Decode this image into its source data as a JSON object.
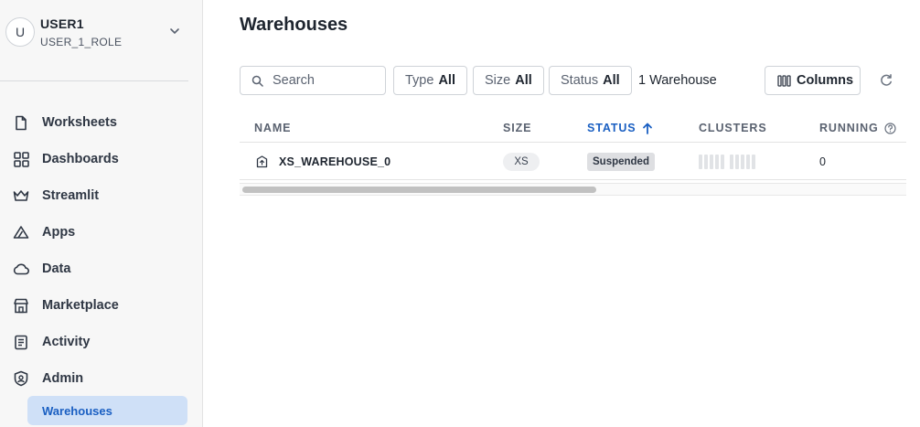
{
  "user": {
    "initial": "U",
    "name": "USER1",
    "role": "USER_1_ROLE"
  },
  "nav": {
    "items": [
      {
        "label": "Worksheets",
        "icon": "document-icon"
      },
      {
        "label": "Dashboards",
        "icon": "grid-icon"
      },
      {
        "label": "Streamlit",
        "icon": "crown-icon"
      },
      {
        "label": "Apps",
        "icon": "apps-icon"
      },
      {
        "label": "Data",
        "icon": "cloud-icon"
      },
      {
        "label": "Marketplace",
        "icon": "store-icon"
      },
      {
        "label": "Activity",
        "icon": "activity-icon"
      },
      {
        "label": "Admin",
        "icon": "shield-icon"
      }
    ],
    "active_sub_item": "Warehouses"
  },
  "main": {
    "title": "Warehouses",
    "search_placeholder": "Search",
    "filters": [
      {
        "label": "Type",
        "value": "All"
      },
      {
        "label": "Size",
        "value": "All"
      },
      {
        "label": "Status",
        "value": "All"
      }
    ],
    "count_text": "1 Warehouse",
    "columns_label": "Columns",
    "accent_color": "#1a5fc2"
  },
  "table": {
    "headers": {
      "name": "NAME",
      "size": "SIZE",
      "status": "STATUS",
      "clusters": "CLUSTERS",
      "running": "RUNNING"
    },
    "sort": {
      "column": "status",
      "direction": "ascending"
    },
    "rows": [
      {
        "name": "XS_WAREHOUSE_0",
        "size": "XS",
        "status": "Suspended",
        "running": "0"
      }
    ]
  }
}
